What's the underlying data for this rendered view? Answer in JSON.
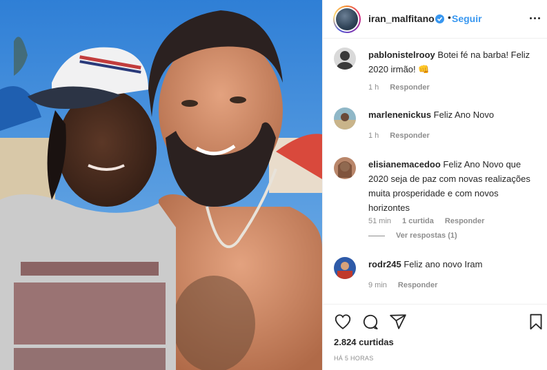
{
  "post": {
    "image_alt": "Selfie at the beach"
  },
  "header": {
    "username": "iran_malfitano",
    "separator": "•",
    "follow_label": "Seguir",
    "verified_icon": "verified-badge-icon",
    "more_icon": "more-options-icon"
  },
  "comments": [
    {
      "username": "pablonistelrooy",
      "text": "Botei fé na barba! Feliz 2020 irmão! 👊",
      "time": "1 h",
      "likes": "",
      "reply_label": "Responder"
    },
    {
      "username": "marlenenickus",
      "text": "Feliz Ano Novo",
      "time": "1 h",
      "likes": "",
      "reply_label": "Responder"
    },
    {
      "username": "elisianemacedoo",
      "text": "Feliz Ano Novo que 2020 seja de paz com novas realizações muita prosperidade e com novos horizontes",
      "time": "51 min",
      "likes": "1 curtida",
      "reply_label": "Responder",
      "view_replies": "Ver respostas (1)"
    },
    {
      "username": "rodr245",
      "text": "Feliz ano novo Iram",
      "time": "9 min",
      "likes": "",
      "reply_label": "Responder"
    }
  ],
  "actions": {
    "like_icon": "heart-icon",
    "comment_icon": "comment-icon",
    "share_icon": "share-icon",
    "save_icon": "bookmark-icon",
    "likes_count": "2.824 curtidas",
    "timestamp": "HÁ 5 HORAS"
  },
  "colors": {
    "link": "#3897f0",
    "text": "#262626",
    "muted": "#8e8e8e",
    "border": "#efefef"
  }
}
